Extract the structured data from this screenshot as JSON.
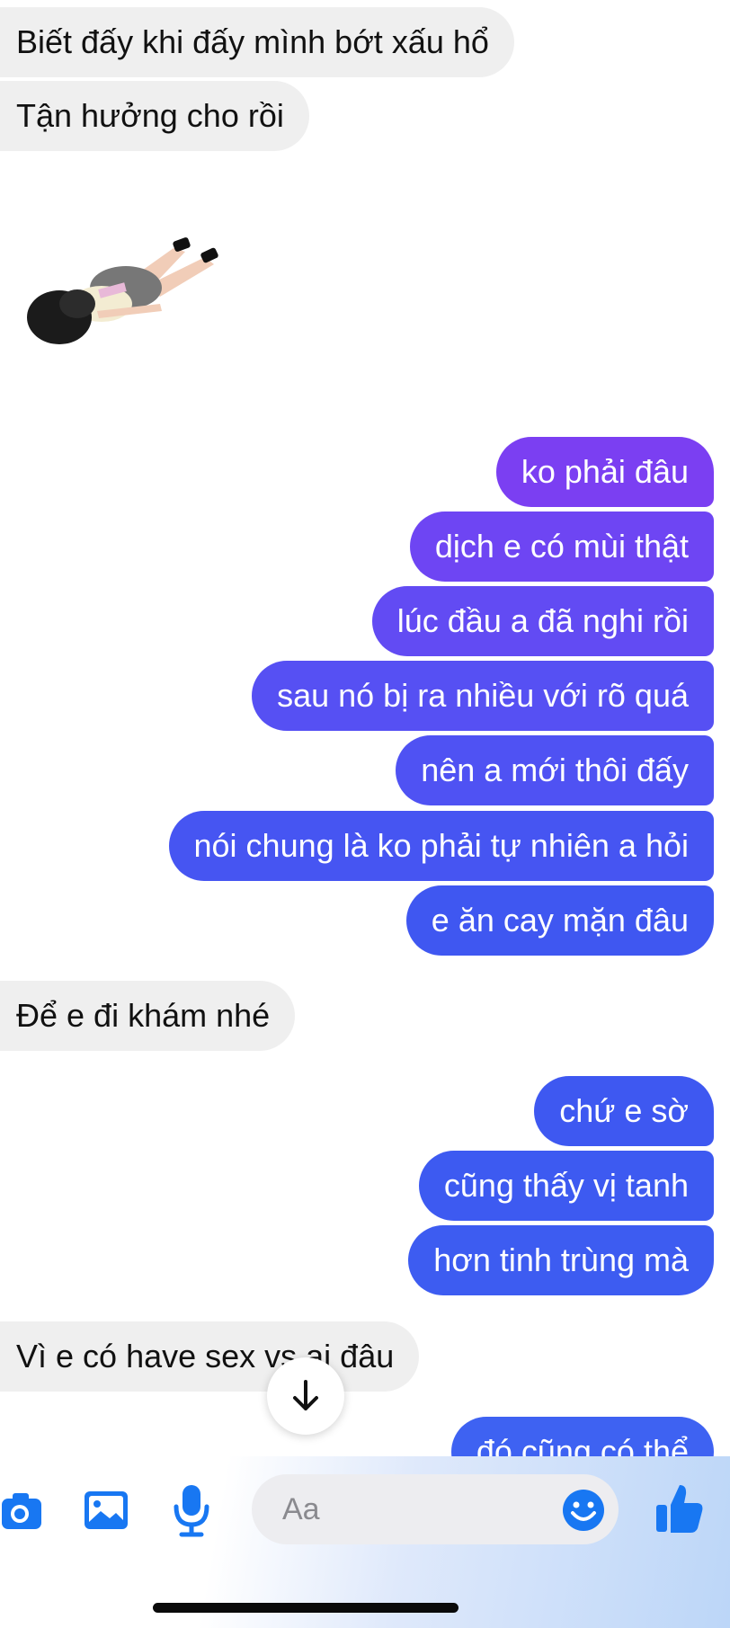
{
  "messages": [
    {
      "id": "m1",
      "direction": "incoming",
      "text": "Biết đấy khi đấy mình bớt xấu hổ"
    },
    {
      "id": "m2",
      "direction": "incoming",
      "text": "Tận hưởng cho rồi"
    },
    {
      "id": "m3",
      "direction": "outgoing",
      "text": "ko phải đâu"
    },
    {
      "id": "m4",
      "direction": "outgoing",
      "text": "dịch e có mùi thật"
    },
    {
      "id": "m5",
      "direction": "outgoing",
      "text": "lúc đầu a đã nghi rồi"
    },
    {
      "id": "m6",
      "direction": "outgoing",
      "text": "sau nó bị ra nhiều với rõ quá"
    },
    {
      "id": "m7",
      "direction": "outgoing",
      "text": "nên a mới thôi đấy"
    },
    {
      "id": "m8",
      "direction": "outgoing",
      "text": "nói chung là ko phải tự nhiên a hỏi"
    },
    {
      "id": "m9",
      "direction": "outgoing",
      "text": "e ăn cay mặn đâu"
    },
    {
      "id": "m10",
      "direction": "incoming",
      "text": "Để e đi khám nhé"
    },
    {
      "id": "m11",
      "direction": "outgoing",
      "text": "chứ e sờ"
    },
    {
      "id": "m12",
      "direction": "outgoing",
      "text": "cũng thấy vị tanh"
    },
    {
      "id": "m13",
      "direction": "outgoing",
      "text": "hơn tinh trùng mà"
    },
    {
      "id": "m14",
      "direction": "incoming",
      "text": "Vì e có have sex vs ai đâu"
    },
    {
      "id": "m15",
      "direction": "outgoing",
      "text": "đó cũng có thể"
    }
  ],
  "sticker": {
    "icon": "lying-girl-sticker"
  },
  "composer": {
    "placeholder": "Aa",
    "camera_icon": "camera-icon",
    "gallery_icon": "image-icon",
    "mic_icon": "microphone-icon",
    "emoji_icon": "smiley-icon",
    "like_icon": "thumbs-up-icon"
  },
  "scroll_down_icon": "arrow-down-icon",
  "colors": {
    "incoming_bubble": "#efefef",
    "outgoing_top": "#7b3ff2",
    "outgoing_bottom": "#3d5af1",
    "accent": "#1877f2"
  }
}
